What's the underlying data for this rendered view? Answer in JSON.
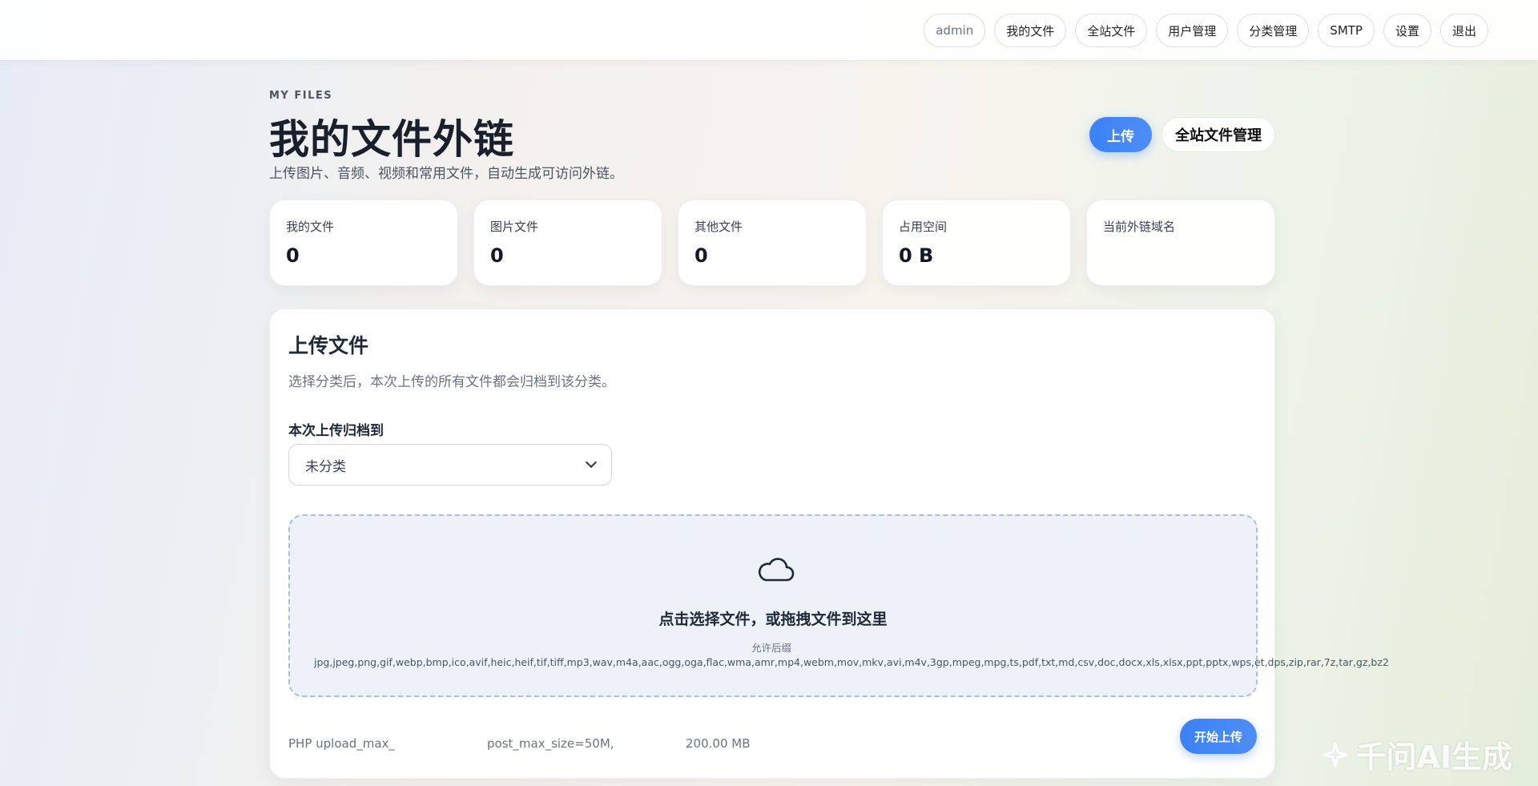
{
  "nav": {
    "user": "admin",
    "items": [
      "我的文件",
      "全站文件",
      "用户管理",
      "分类管理",
      "SMTP",
      "设置",
      "退出"
    ]
  },
  "header": {
    "eyebrow": "MY FILES",
    "title": "我的文件外链",
    "subtitle": "上传图片、音频、视频和常用文件，自动生成可访问外链。",
    "upload_button": "上传",
    "admin_button": "全站文件管理"
  },
  "stats": [
    {
      "label": "我的文件",
      "value": "0"
    },
    {
      "label": "图片文件",
      "value": "0"
    },
    {
      "label": "其他文件",
      "value": "0"
    },
    {
      "label": "占用空间",
      "value": "0 B"
    },
    {
      "label": "当前外链域名",
      "value": ""
    }
  ],
  "upload": {
    "title": "上传文件",
    "description": "选择分类后，本次上传的所有文件都会归档到该分类。",
    "category_label": "本次上传归档到",
    "category_selected": "未分类",
    "drop_title": "点击选择文件，或拖拽文件到这里",
    "allowed_prefix": "允许后缀",
    "allowed_types": "jpg,jpeg,png,gif,webp,bmp,ico,avif,heic,heif,tif,tiff,mp3,wav,m4a,aac,ogg,oga,flac,wma,amr,mp4,webm,mov,mkv,avi,m4v,3gp,mpeg,mpg,ts,pdf,txt,md,csv,doc,docx,xls,xlsx,ppt,pptx,wps,et,dps,zip,rar,7z,tar,gz,bz2",
    "limit_upload": "PHP upload_max_",
    "limit_post": "post_max_size=50M,",
    "limit_other": "200.00 MB",
    "start_button": "开始上传"
  },
  "watermark": "千问AI生成"
}
